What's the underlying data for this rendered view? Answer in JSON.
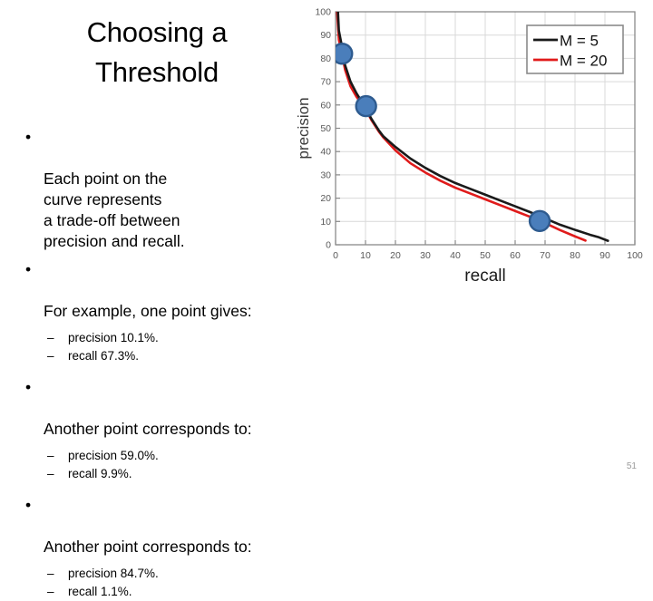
{
  "slide": {
    "title": "Choosing a\nThreshold",
    "slide_number": "51",
    "bullets": [
      {
        "mark": "•",
        "text": "Each point on the\ncurve represents\na trade-off between\nprecision and recall."
      },
      {
        "mark": "•",
        "text": "For example, one point gives:",
        "sub": [
          {
            "mark": "–",
            "text": "precision 10.1%."
          },
          {
            "mark": "–",
            "text": "recall 67.3%."
          }
        ]
      },
      {
        "mark": "•",
        "text": "Another point corresponds to:",
        "sub": [
          {
            "mark": "–",
            "text": "precision 59.0%."
          },
          {
            "mark": "–",
            "text": "recall 9.9%."
          }
        ]
      },
      {
        "mark": "•",
        "text": "Another point corresponds to:",
        "sub": [
          {
            "mark": "–",
            "text": "precision 84.7%."
          },
          {
            "mark": "–",
            "text": "recall 1.1%."
          }
        ]
      }
    ]
  },
  "chart_data": {
    "type": "line",
    "title": "",
    "xlabel": "recall",
    "ylabel": "precision",
    "xlim": [
      0,
      100
    ],
    "ylim": [
      0,
      100
    ],
    "xticks": [
      0,
      10,
      20,
      30,
      40,
      50,
      60,
      70,
      80,
      90,
      100
    ],
    "yticks": [
      0,
      10,
      20,
      30,
      40,
      50,
      60,
      70,
      80,
      90,
      100
    ],
    "grid": true,
    "legend_position": "top-right",
    "series": [
      {
        "name": "M = 5",
        "color": "#1a1a1a",
        "x": [
          0.8,
          1.1,
          2.2,
          3.2,
          5.0,
          7.0,
          9.9,
          12.0,
          14.5,
          16.0,
          20.0,
          25.0,
          30.0,
          35.0,
          40.0,
          45.0,
          50.0,
          55.0,
          60.0,
          65.0,
          67.3,
          70.0,
          75.0,
          80.0,
          85.0,
          88.0,
          91.0
        ],
        "y": [
          100.0,
          92.0,
          84.7,
          77.0,
          70.0,
          65.0,
          59.0,
          54.0,
          49.0,
          46.5,
          42.0,
          37.0,
          33.0,
          29.5,
          26.5,
          24.0,
          21.5,
          19.0,
          16.5,
          14.0,
          12.8,
          11.3,
          8.6,
          6.4,
          4.3,
          3.2,
          1.7
        ]
      },
      {
        "name": "M = 20",
        "color": "#e01b1b",
        "x": [
          0.5,
          1.1,
          2.2,
          3.2,
          5.0,
          7.0,
          9.9,
          12.0,
          14.5,
          16.0,
          20.0,
          25.0,
          30.0,
          35.0,
          40.0,
          45.0,
          50.0,
          55.0,
          60.0,
          65.0,
          67.3,
          70.0,
          75.0,
          80.0,
          83.5
        ],
        "y": [
          100.0,
          88.0,
          81.5,
          75.0,
          68.0,
          63.5,
          58.5,
          53.5,
          48.5,
          46.0,
          40.5,
          35.0,
          31.0,
          27.5,
          24.5,
          22.0,
          19.5,
          17.0,
          14.5,
          12.0,
          11.0,
          9.3,
          6.3,
          3.6,
          1.8
        ]
      }
    ],
    "markers": [
      {
        "x": 2.2,
        "y": 82.0,
        "label": "precision 84.7% / recall 1.1%"
      },
      {
        "x": 10.2,
        "y": 59.5,
        "label": "precision 59.0% / recall 9.9%"
      },
      {
        "x": 68.2,
        "y": 10.2,
        "label": "precision 10.1% / recall 67.3%"
      }
    ],
    "marker_fill": "#4a7ebb",
    "marker_stroke": "#2e5b8f",
    "axis_color": "#8a8a8a",
    "grid_color": "#d9d9d9",
    "tick_label_color": "#595959"
  }
}
